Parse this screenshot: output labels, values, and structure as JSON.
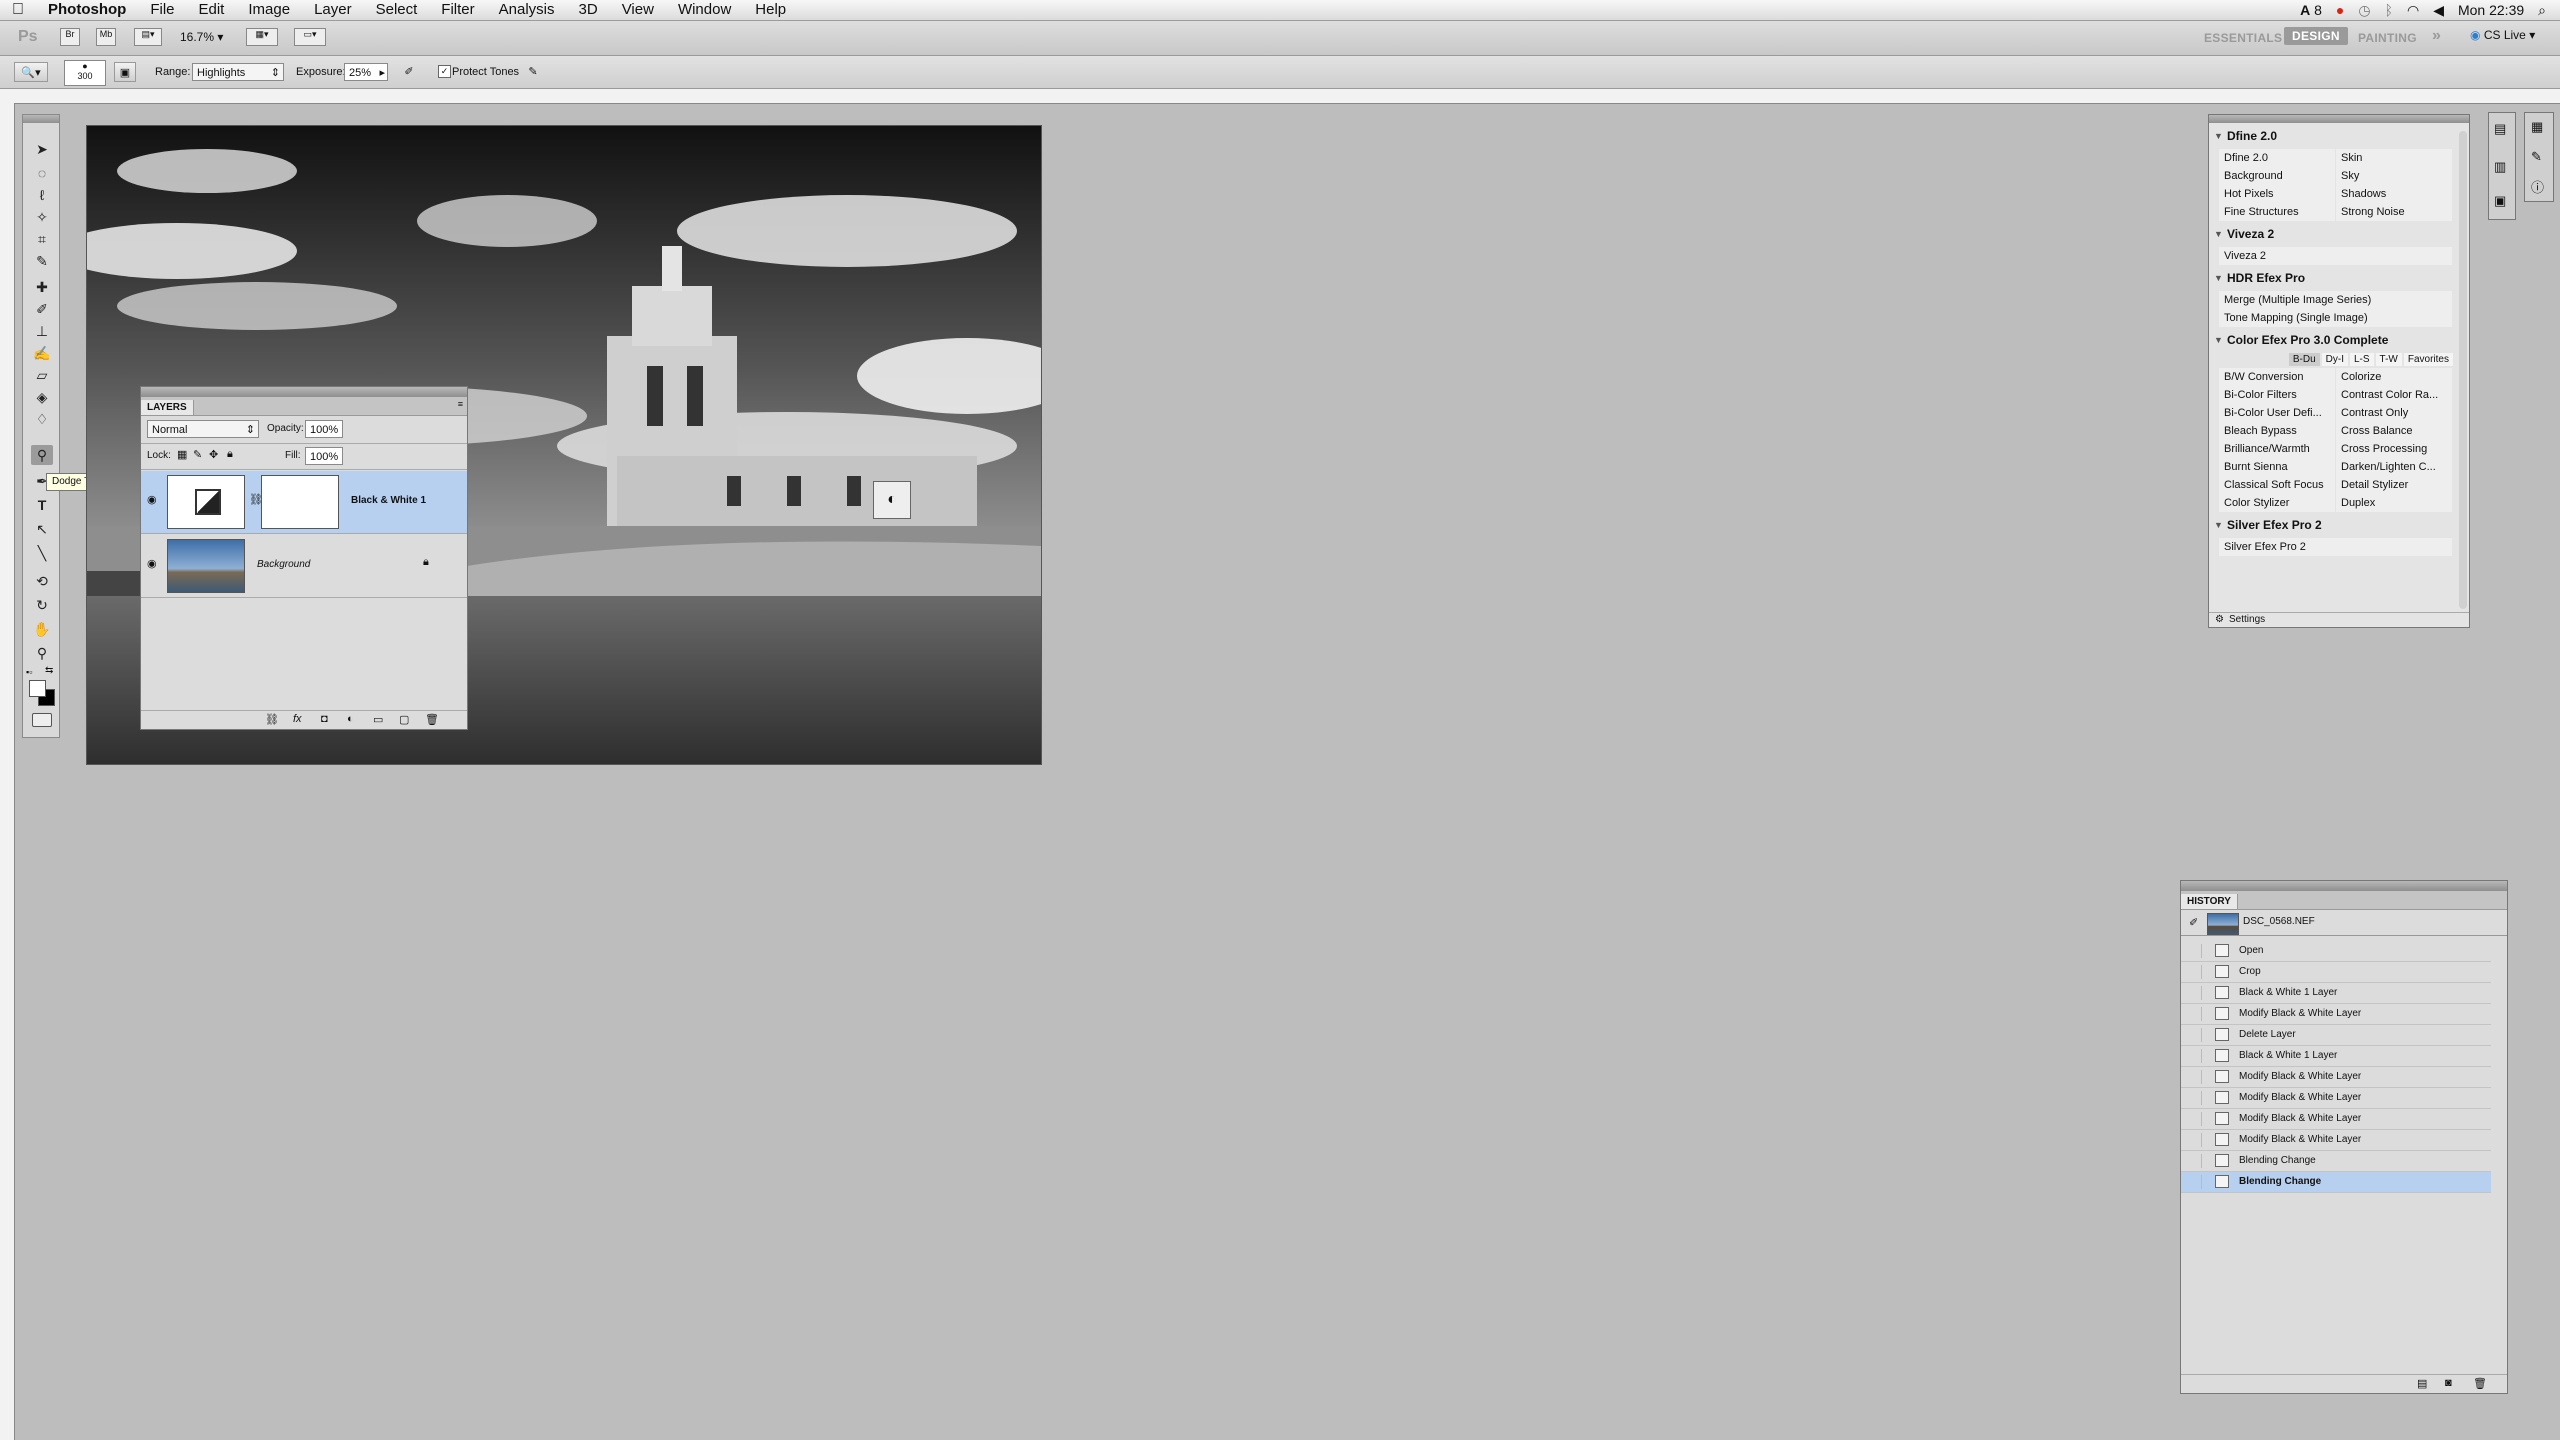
{
  "menubar": {
    "app": "Photoshop",
    "items": [
      "File",
      "Edit",
      "Image",
      "Layer",
      "Select",
      "Filter",
      "Analysis",
      "3D",
      "View",
      "Window",
      "Help"
    ],
    "right": {
      "adobe_badge": "8",
      "clock": "Mon 22:39"
    }
  },
  "appbar": {
    "logo": "Ps",
    "zoom": "16.7%",
    "workspaces": {
      "essentials": "ESSENTIALS",
      "design": "DESIGN",
      "painting": "PAINTING",
      "more": "»"
    },
    "cs_live": "CS Live"
  },
  "options": {
    "brush_size": "300",
    "range_label": "Range:",
    "range_value": "Highlights",
    "exposure_label": "Exposure:",
    "exposure_value": "25%",
    "protect_tones": "Protect Tones"
  },
  "tools": {
    "tooltip": "Dodge Tool (O)"
  },
  "layers_panel": {
    "tab": "LAYERS",
    "blend_mode": "Normal",
    "opacity_label": "Opacity:",
    "opacity_value": "100%",
    "lock_label": "Lock:",
    "fill_label": "Fill:",
    "fill_value": "100%",
    "layers": [
      {
        "name": "Black & White 1"
      },
      {
        "name": "Background"
      }
    ]
  },
  "plugins_panel": {
    "sections": [
      {
        "title": "Dfine 2.0",
        "rows": [
          [
            "Dfine 2.0",
            "Skin"
          ],
          [
            "Background",
            "Sky"
          ],
          [
            "Hot Pixels",
            "Shadows"
          ],
          [
            "Fine Structures",
            "Strong Noise"
          ]
        ]
      },
      {
        "title": "Viveza 2",
        "rows": [
          [
            "Viveza 2"
          ]
        ]
      },
      {
        "title": "HDR Efex Pro",
        "rows": [
          [
            "Merge (Multiple Image Series)"
          ],
          [
            "Tone Mapping (Single Image)"
          ]
        ]
      },
      {
        "title": "Color Efex Pro 3.0 Complete",
        "tabs": [
          "B-Du",
          "Dy-I",
          "L-S",
          "T-W",
          "Favorites"
        ],
        "rows": [
          [
            "B/W Conversion",
            "Colorize"
          ],
          [
            "Bi-Color Filters",
            "Contrast Color Ra..."
          ],
          [
            "Bi-Color User Defi...",
            "Contrast Only"
          ],
          [
            "Bleach Bypass",
            "Cross Balance"
          ],
          [
            "Brilliance/Warmth",
            "Cross Processing"
          ],
          [
            "Burnt Sienna",
            "Darken/Lighten C..."
          ],
          [
            "Classical Soft Focus",
            "Detail Stylizer"
          ],
          [
            "Color Stylizer",
            "Duplex"
          ]
        ]
      },
      {
        "title": "Silver Efex Pro 2",
        "rows": [
          [
            "Silver Efex Pro 2"
          ]
        ]
      }
    ],
    "settings": "Settings"
  },
  "history_panel": {
    "tab": "HISTORY",
    "snapshot": "DSC_0568.NEF",
    "states": [
      "Open",
      "Crop",
      "Black & White 1 Layer",
      "Modify Black & White Layer",
      "Delete Layer",
      "Black & White 1 Layer",
      "Modify Black & White Layer",
      "Modify Black & White Layer",
      "Modify Black & White Layer",
      "Modify Black & White Layer",
      "Blending Change",
      "Blending Change"
    ]
  }
}
